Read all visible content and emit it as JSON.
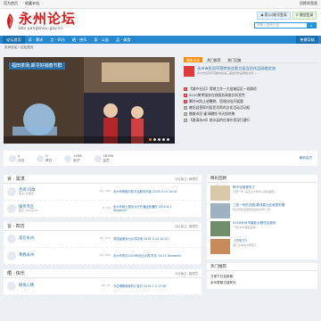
{
  "topbar": {
    "items": [
      "设为首页",
      "收藏本站"
    ],
    "right": [
      "切换到宽版",
      ""
    ]
  },
  "header": {
    "title": "永州论坛",
    "url": "bbs.yongzhou.gov.cn",
    "qq_btn": "用QQ帐号登录",
    "wx_btn": "微信登录",
    "search_placeholder": "请输入搜索内容",
    "search_btn": "搜索"
  },
  "nav": {
    "items": [
      "论坛首页",
      "诉 · 需求",
      "言 · 四方",
      "晒 · 快乐",
      "家 · 公益",
      "品 · 美食"
    ],
    "right": "快捷导航"
  },
  "breadcrumb": "永州论坛 › 论坛首页",
  "slider": {
    "caption": "福田茶场,邮寻好销春节群",
    "dots": 5,
    "active_dot": 0
  },
  "hot": {
    "tabs": [
      "最新发表",
      "热门推荐",
      "热门回复"
    ],
    "headline": "永州市民同乐营跨协会第三届会员作品网络交流",
    "summary": "永州市民同乐营跨协会第三届会员作品网络交流……",
    "list": [
      "【城乡社区】零陵工作一大批基层区一线群综",
      "2020美孝服务在线服务调查分析宣传",
      "腾并州防止放鞭炮、悟镜分陪开展整",
      "雍阳县营帮村居民早帮的文化活动活动组",
      "赠美市民'童'晴赠东书天保供贿",
      "【路满永州】前水县的在海外资深打建行"
    ]
  },
  "stats": [
    {
      "label": "今日",
      "value": "0"
    },
    {
      "label": "昨日",
      "value": "0"
    },
    {
      "label": "帖子",
      "value": "1056"
    },
    {
      "label": "会员",
      "value": "28196"
    }
  ],
  "stats_link": "最新会员",
  "sections": [
    {
      "title": "诉 · 需求",
      "mod": "分区版主: 管理员",
      "forums": [
        {
          "name": "咨询 问政",
          "sub": "版主: 管理员",
          "count": "22 / 155",
          "last": "永州市网络问政平台服务升级 2019-5-24 10:20"
        },
        {
          "name": "服务专区",
          "sub": "版主: Wxadmin",
          "count": "6 / 41",
          "last": "永州市网上服务大厅开通运营通知 2019-6-1 Wxadmin"
        }
      ]
    },
    {
      "title": "言 · 四方",
      "mod": "分区版主: 管理员",
      "forums": [
        {
          "name": "美在永州",
          "sub": "",
          "count": "48 / 217",
          "last": "寻找最美永州乡村民宿 2019-5-24 10:20"
        },
        {
          "name": "青春永州",
          "sub": "",
          "count": "56 / 292",
          "last": "永州市举办2019年创业大赛 昨天 10:27 Wxadmin"
        }
      ]
    },
    {
      "title": "晒 · 快乐",
      "mod": "分区版主: 管理员",
      "forums": [
        {
          "name": "植快心情",
          "sub": "",
          "count": "18 / 97",
          "last": "今日晒晒我家的小宝贝 2019-7-4 17:00"
        }
      ]
    }
  ],
  "right": {
    "featured_title": "精彩回顾",
    "featured": [
      {
        "title": "鸭子也够爱吃了",
        "sub": "王阳一号: 是五彩大鸭可以到处都吃..."
      },
      {
        "title": "三亚一号的花园,跟邻居比比谁更好看",
        "sub": "吃过早饭去家附近的地方转一转..."
      },
      {
        "title": "2018永州市摄影大赛作品赏析",
        "sub": "一份2018美丽画卷..."
      },
      {
        "title": "《夕阳下》",
        "sub": "湘江东岸边夕阳西下..."
      }
    ],
    "hot_title": "热门推荐",
    "hot_list": [
      "万家千红迎新春",
      "永州零陵古城风光"
    ]
  }
}
